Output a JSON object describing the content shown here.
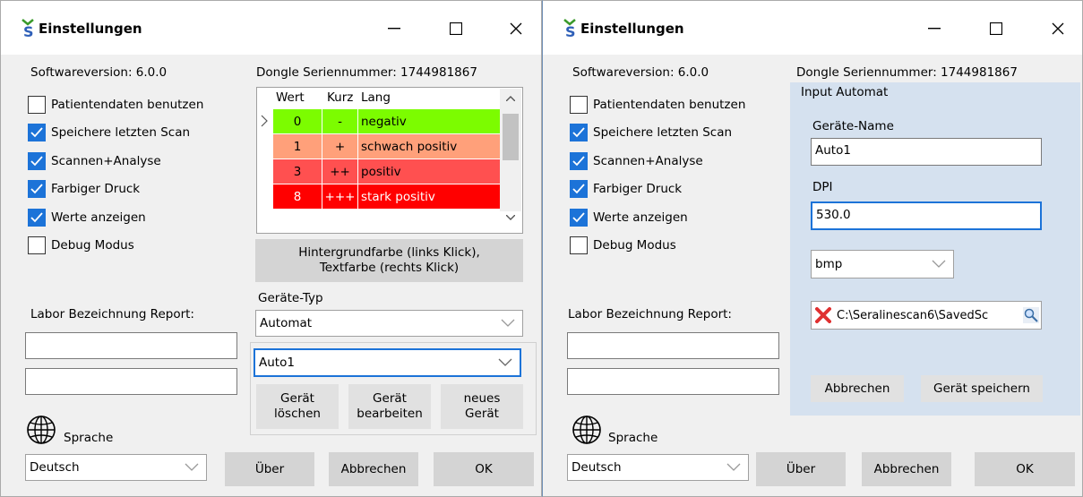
{
  "left": {
    "title": "Einstellungen",
    "software_version": "Softwareversion: 6.0.0",
    "dongle": "Dongle Seriennummer: 1744981867",
    "checkboxes": [
      {
        "label": "Patientendaten benutzen",
        "checked": false
      },
      {
        "label": "Speichere letzten Scan",
        "checked": true
      },
      {
        "label": "Scannen+Analyse",
        "checked": true
      },
      {
        "label": "Farbiger Druck",
        "checked": true
      },
      {
        "label": "Werte anzeigen",
        "checked": true
      },
      {
        "label": "Debug Modus",
        "checked": false
      }
    ],
    "grid": {
      "headers": [
        "Wert",
        "Kurz",
        "Lang"
      ],
      "rows": [
        {
          "wert": "0",
          "kurz": "-",
          "lang": "negativ",
          "bg": "#7cfc00",
          "fg": "#000000"
        },
        {
          "wert": "1",
          "kurz": "+",
          "lang": "schwach positiv",
          "bg": "#ffa07a",
          "fg": "#000000"
        },
        {
          "wert": "3",
          "kurz": "++",
          "lang": "positiv",
          "bg": "#ff5050",
          "fg": "#000000"
        },
        {
          "wert": "8",
          "kurz": "+++",
          "lang": "stark positiv",
          "bg": "#ff0000",
          "fg": "#ffffff"
        }
      ]
    },
    "color_button": "Hintergrundfarbe (links Klick), Textfarbe (rechts Klick)",
    "geraete_typ_label": "Geräte-Typ",
    "geraete_typ_value": "Automat",
    "geraet_value": "Auto1",
    "btn_geraet_loeschen": "Gerät löschen",
    "btn_geraet_bearbeiten": "Gerät bearbeiten",
    "btn_neues_geraet": "neues Gerät",
    "labor_label": "Labor Bezeichnung Report:",
    "labor_line1": "",
    "labor_line2": "",
    "sprache_label": "Sprache",
    "sprache_value": "Deutsch",
    "btn_ueber": "Über",
    "btn_abbrechen": "Abbrechen",
    "btn_ok": "OK"
  },
  "right": {
    "title": "Einstellungen",
    "software_version": "Softwareversion: 6.0.0",
    "dongle": "Dongle Seriennummer: 1744981867",
    "checkboxes": [
      {
        "label": "Patientendaten benutzen",
        "checked": false
      },
      {
        "label": "Speichere letzten Scan",
        "checked": true
      },
      {
        "label": "Scannen+Analyse",
        "checked": true
      },
      {
        "label": "Farbiger Druck",
        "checked": true
      },
      {
        "label": "Werte anzeigen",
        "checked": true
      },
      {
        "label": "Debug Modus",
        "checked": false
      }
    ],
    "panel_title": "Input Automat",
    "geraete_name_label": "Geräte-Name",
    "geraete_name_value": "Auto1",
    "dpi_label": "DPI",
    "dpi_value": "530.0",
    "format_value": "bmp",
    "path_value": "C:\\Seralinescan6\\SavedSc",
    "btn_panel_abbrechen": "Abbrechen",
    "btn_geraet_speichern": "Gerät speichern",
    "labor_label": "Labor Bezeichnung Report:",
    "labor_line1": "",
    "labor_line2": "",
    "sprache_label": "Sprache",
    "sprache_value": "Deutsch",
    "btn_ueber": "Über",
    "btn_abbrechen": "Abbrechen",
    "btn_ok": "OK"
  },
  "colors": {
    "accent": "#1c73d8",
    "panel": "#d5e1ef"
  }
}
